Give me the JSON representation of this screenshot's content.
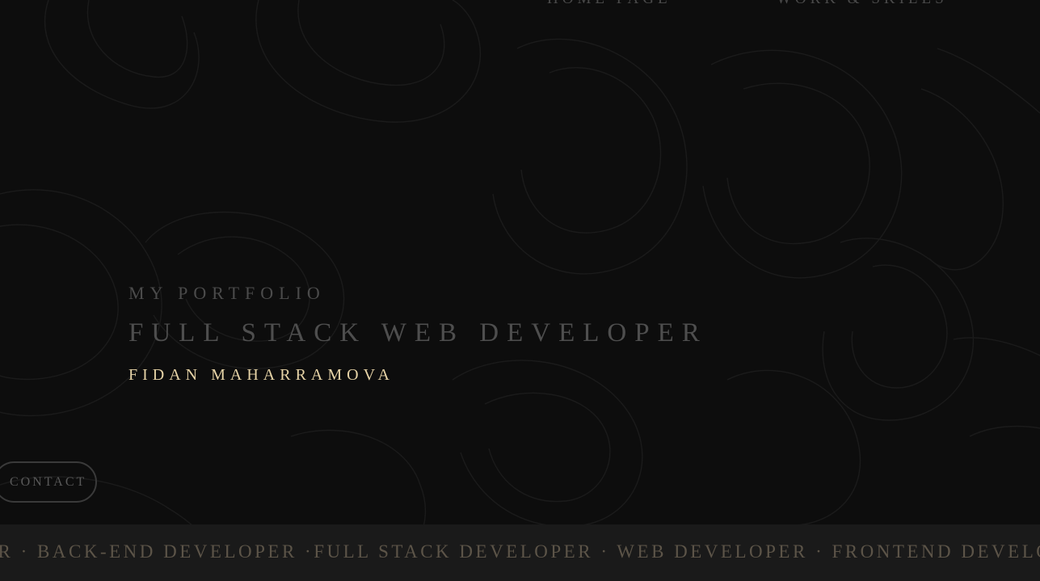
{
  "nav": {
    "items": [
      {
        "label": "HOME PAGE"
      },
      {
        "label": "WORK & SKILLS"
      }
    ]
  },
  "hero": {
    "eyebrow": "MY PORTFOLIO",
    "title": "FULL STACK WEB DEVELOPER",
    "name": "FIDAN MAHARRAMOVA"
  },
  "contact": {
    "label": "CONTACT"
  },
  "marquee": {
    "text": "ER · BACK-END DEVELOPER ·FULL STACK DEVELOPER · WEB DEVELOPER · FRONTEND DEVELOPER"
  },
  "colors": {
    "background": "#0d0d0d",
    "accent_name": "#e6d3a6",
    "muted_text": "#4e4e4e",
    "marquee_band": "#1a1a1a",
    "marquee_text": "#5c5448"
  }
}
